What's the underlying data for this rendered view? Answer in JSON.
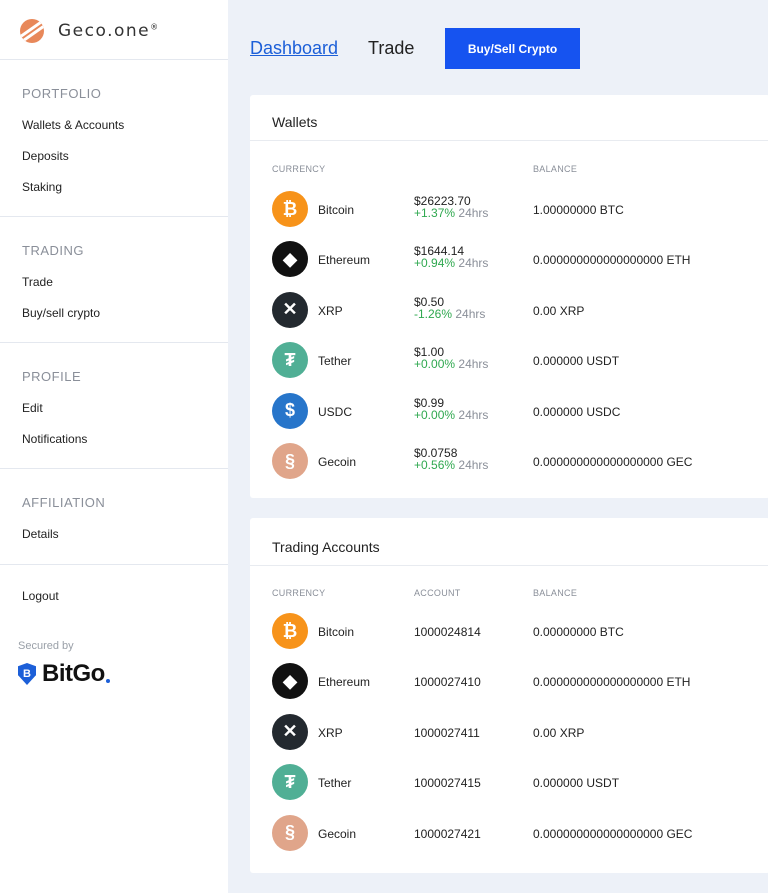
{
  "brand": {
    "name": "Geco.one",
    "trademark": "®"
  },
  "sidebar": {
    "sections": [
      {
        "title": "PORTFOLIO",
        "items": [
          "Wallets & Accounts",
          "Deposits",
          "Staking"
        ]
      },
      {
        "title": "TRADING",
        "items": [
          "Trade",
          "Buy/sell crypto"
        ]
      },
      {
        "title": "PROFILE",
        "items": [
          "Edit",
          "Notifications"
        ]
      },
      {
        "title": "AFFILIATION",
        "items": [
          "Details"
        ]
      }
    ],
    "logout": "Logout",
    "secured_by": "Secured by",
    "bitgo": "BitGo"
  },
  "topbar": {
    "dashboard": "Dashboard",
    "trade": "Trade",
    "buy_sell": "Buy/Sell Crypto"
  },
  "wallets": {
    "title": "Wallets",
    "headers": {
      "currency": "CURRENCY",
      "balance": "BALANCE"
    },
    "rows": [
      {
        "name": "Bitcoin",
        "icon": "bitcoin-icon",
        "price": "$26223.70",
        "change": "+1.37%",
        "period": "24hrs",
        "balance": "1.00000000 BTC",
        "color": "#f7931a",
        "glyph": "₿"
      },
      {
        "name": "Ethereum",
        "icon": "ethereum-icon",
        "price": "$1644.14",
        "change": "+0.94%",
        "period": "24hrs",
        "balance": "0.000000000000000000 ETH",
        "color": "#111111",
        "glyph": "◆"
      },
      {
        "name": "XRP",
        "icon": "xrp-icon",
        "price": "$0.50",
        "change": "-1.26%",
        "period": "24hrs",
        "balance": "0.00 XRP",
        "color": "#23292f",
        "glyph": "✕"
      },
      {
        "name": "Tether",
        "icon": "tether-icon",
        "price": "$1.00",
        "change": "+0.00%",
        "period": "24hrs",
        "balance": "0.000000 USDT",
        "color": "#50af95",
        "glyph": "₮"
      },
      {
        "name": "USDC",
        "icon": "usdc-icon",
        "price": "$0.99",
        "change": "+0.00%",
        "period": "24hrs",
        "balance": "0.000000 USDC",
        "color": "#2775ca",
        "glyph": "$"
      },
      {
        "name": "Gecoin",
        "icon": "gecoin-icon",
        "price": "$0.0758",
        "change": "+0.56%",
        "period": "24hrs",
        "balance": "0.000000000000000000 GEC",
        "color": "#e0a58a",
        "glyph": "§"
      }
    ]
  },
  "trading_accounts": {
    "title": "Trading Accounts",
    "headers": {
      "currency": "CURRENCY",
      "account": "ACCOUNT",
      "balance": "BALANCE"
    },
    "rows": [
      {
        "name": "Bitcoin",
        "icon": "bitcoin-icon",
        "account": "1000024814",
        "balance": "0.00000000 BTC",
        "color": "#f7931a",
        "glyph": "₿"
      },
      {
        "name": "Ethereum",
        "icon": "ethereum-icon",
        "account": "1000027410",
        "balance": "0.000000000000000000 ETH",
        "color": "#111111",
        "glyph": "◆"
      },
      {
        "name": "XRP",
        "icon": "xrp-icon",
        "account": "1000027411",
        "balance": "0.00 XRP",
        "color": "#23292f",
        "glyph": "✕"
      },
      {
        "name": "Tether",
        "icon": "tether-icon",
        "account": "1000027415",
        "balance": "0.000000 USDT",
        "color": "#50af95",
        "glyph": "₮"
      },
      {
        "name": "Gecoin",
        "icon": "gecoin-icon",
        "account": "1000027421",
        "balance": "0.000000000000000000 GEC",
        "color": "#e0a58a",
        "glyph": "§"
      }
    ]
  }
}
